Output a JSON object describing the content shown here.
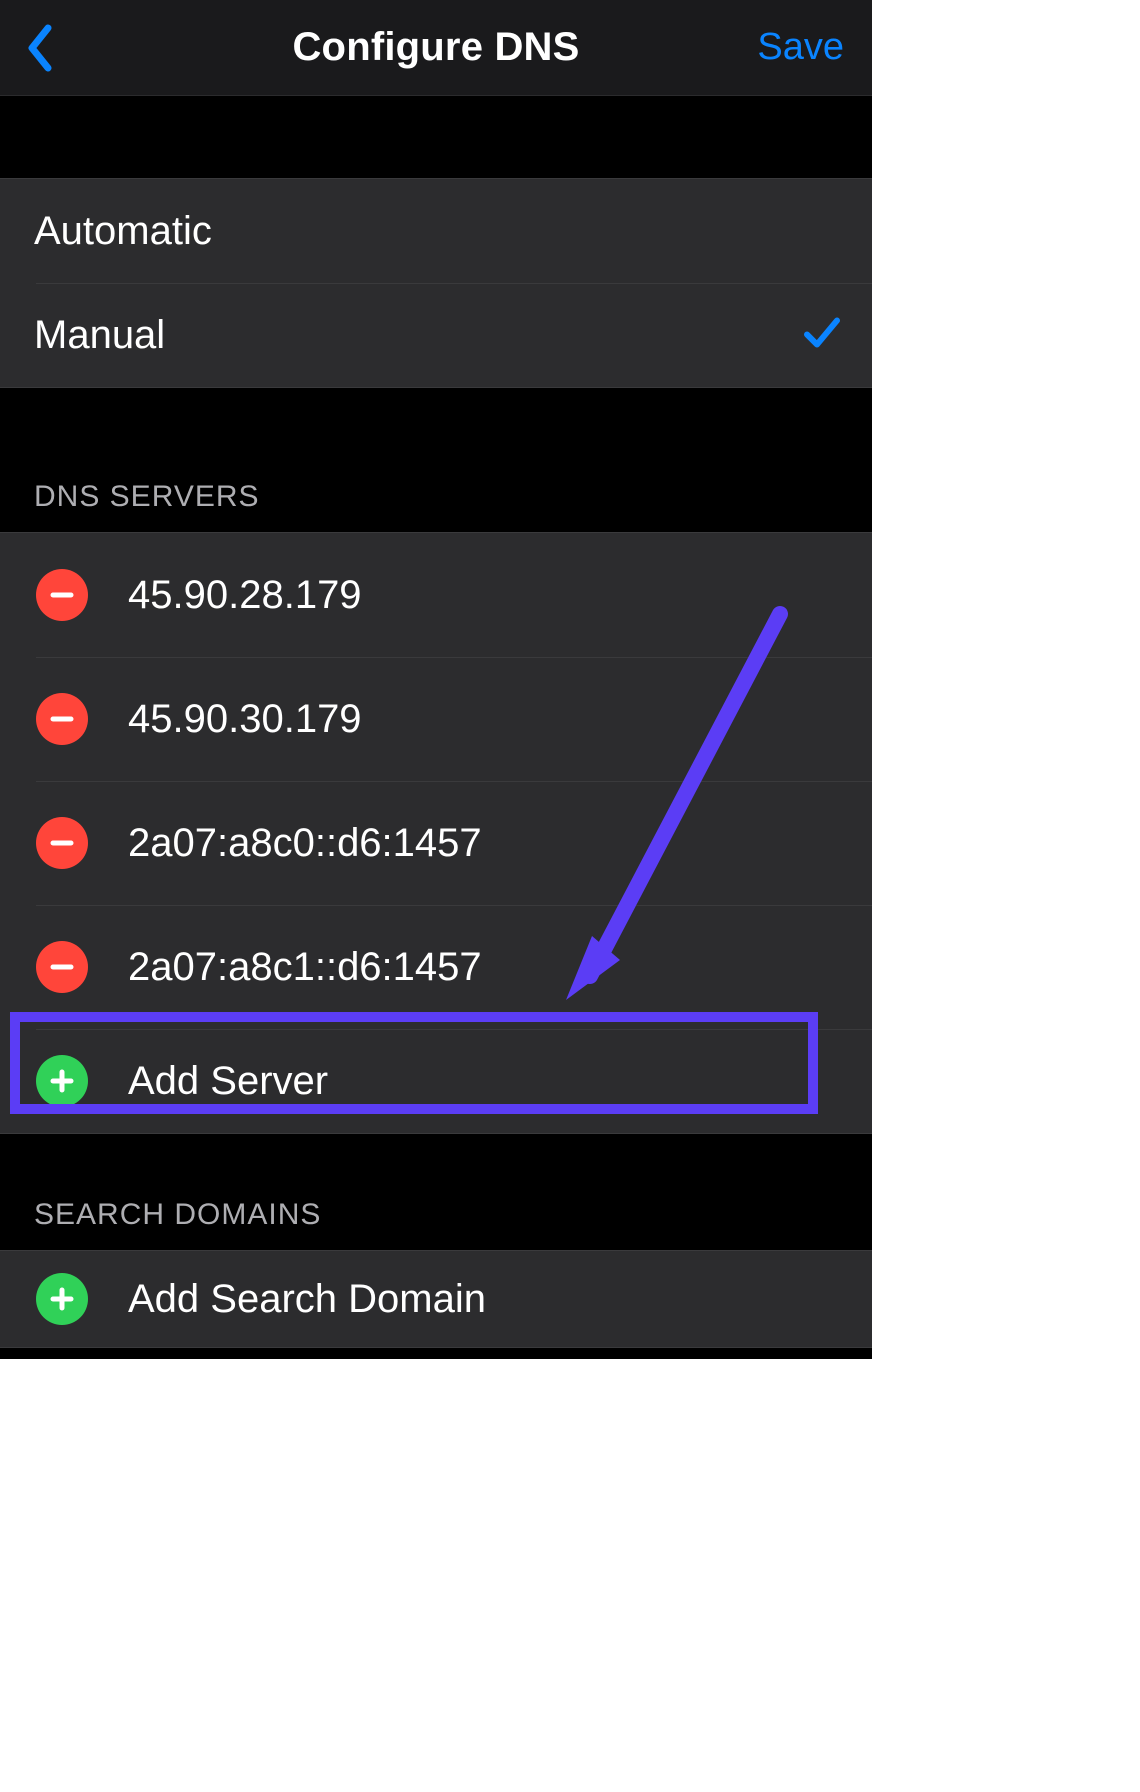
{
  "header": {
    "title": "Configure DNS",
    "save_label": "Save"
  },
  "mode": {
    "automatic_label": "Automatic",
    "manual_label": "Manual",
    "selected": "manual"
  },
  "dns": {
    "section_label": "DNS SERVERS",
    "servers": [
      "45.90.28.179",
      "45.90.30.179",
      "2a07:a8c0::d6:1457",
      "2a07:a8c1::d6:1457"
    ],
    "add_label": "Add Server"
  },
  "search_domains": {
    "section_label": "SEARCH DOMAINS",
    "add_label": "Add Search Domain"
  },
  "annotation": {
    "highlight_color": "#5b3df5"
  }
}
